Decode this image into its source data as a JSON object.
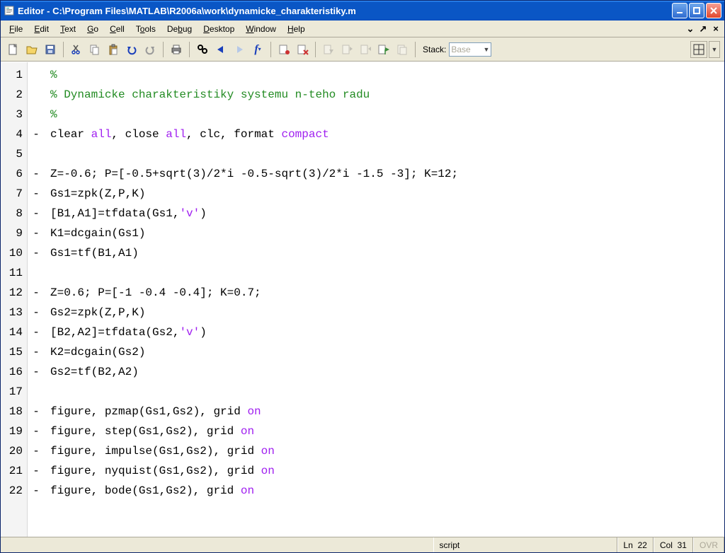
{
  "title": "Editor - C:\\Program Files\\MATLAB\\R2006a\\work\\dynamicke_charakteristiky.m",
  "menubar": {
    "file": "File",
    "edit": "Edit",
    "text": "Text",
    "go": "Go",
    "cell": "Cell",
    "tools": "Tools",
    "debug": "Debug",
    "desktop": "Desktop",
    "window": "Window",
    "help": "Help"
  },
  "toolbar": {
    "stack_label": "Stack:",
    "stack_value": "Base"
  },
  "code": {
    "lines": [
      {
        "n": 1,
        "exec": false,
        "tokens": [
          [
            "c-comment",
            "%"
          ]
        ]
      },
      {
        "n": 2,
        "exec": false,
        "tokens": [
          [
            "c-comment",
            "% Dynamicke charakteristiky systemu n-teho radu"
          ]
        ]
      },
      {
        "n": 3,
        "exec": false,
        "tokens": [
          [
            "c-comment",
            "%"
          ]
        ]
      },
      {
        "n": 4,
        "exec": true,
        "tokens": [
          [
            "",
            "clear "
          ],
          [
            "c-lit",
            "all"
          ],
          [
            "",
            ", close "
          ],
          [
            "c-lit",
            "all"
          ],
          [
            "",
            ", clc, format "
          ],
          [
            "c-lit",
            "compact"
          ]
        ]
      },
      {
        "n": 5,
        "exec": false,
        "tokens": [
          [
            "",
            ""
          ]
        ]
      },
      {
        "n": 6,
        "exec": true,
        "tokens": [
          [
            "",
            "Z=-0.6; P=[-0.5+sqrt(3)/2*i -0.5-sqrt(3)/2*i -1.5 -3]; K=12;"
          ]
        ]
      },
      {
        "n": 7,
        "exec": true,
        "tokens": [
          [
            "",
            "Gs1=zpk(Z,P,K)"
          ]
        ]
      },
      {
        "n": 8,
        "exec": true,
        "tokens": [
          [
            "",
            "[B1,A1]=tfdata(Gs1,"
          ],
          [
            "c-string",
            "'v'"
          ],
          [
            "",
            ")"
          ]
        ]
      },
      {
        "n": 9,
        "exec": true,
        "tokens": [
          [
            "",
            "K1=dcgain(Gs1)"
          ]
        ]
      },
      {
        "n": 10,
        "exec": true,
        "tokens": [
          [
            "",
            "Gs1=tf(B1,A1)"
          ]
        ]
      },
      {
        "n": 11,
        "exec": false,
        "tokens": [
          [
            "",
            ""
          ]
        ]
      },
      {
        "n": 12,
        "exec": true,
        "tokens": [
          [
            "",
            "Z=0.6; P=[-1 -0.4 -0.4]; K=0.7;"
          ]
        ]
      },
      {
        "n": 13,
        "exec": true,
        "tokens": [
          [
            "",
            "Gs2=zpk(Z,P,K)"
          ]
        ]
      },
      {
        "n": 14,
        "exec": true,
        "tokens": [
          [
            "",
            "[B2,A2]=tfdata(Gs2,"
          ],
          [
            "c-string",
            "'v'"
          ],
          [
            "",
            ")"
          ]
        ]
      },
      {
        "n": 15,
        "exec": true,
        "tokens": [
          [
            "",
            "K2=dcgain(Gs2)"
          ]
        ]
      },
      {
        "n": 16,
        "exec": true,
        "tokens": [
          [
            "",
            "Gs2=tf(B2,A2)"
          ]
        ]
      },
      {
        "n": 17,
        "exec": false,
        "tokens": [
          [
            "",
            ""
          ]
        ]
      },
      {
        "n": 18,
        "exec": true,
        "tokens": [
          [
            "",
            "figure, pzmap(Gs1,Gs2), grid "
          ],
          [
            "c-lit",
            "on"
          ]
        ]
      },
      {
        "n": 19,
        "exec": true,
        "tokens": [
          [
            "",
            "figure, step(Gs1,Gs2), grid "
          ],
          [
            "c-lit",
            "on"
          ]
        ]
      },
      {
        "n": 20,
        "exec": true,
        "tokens": [
          [
            "",
            "figure, impulse(Gs1,Gs2), grid "
          ],
          [
            "c-lit",
            "on"
          ]
        ]
      },
      {
        "n": 21,
        "exec": true,
        "tokens": [
          [
            "",
            "figure, nyquist(Gs1,Gs2), grid "
          ],
          [
            "c-lit",
            "on"
          ]
        ]
      },
      {
        "n": 22,
        "exec": true,
        "tokens": [
          [
            "",
            "figure, bode(Gs1,Gs2), grid "
          ],
          [
            "c-lit",
            "on"
          ]
        ]
      }
    ]
  },
  "status": {
    "type": "script",
    "ln_label": "Ln",
    "ln": "22",
    "col_label": "Col",
    "col": "31",
    "ovr": "OVR"
  }
}
